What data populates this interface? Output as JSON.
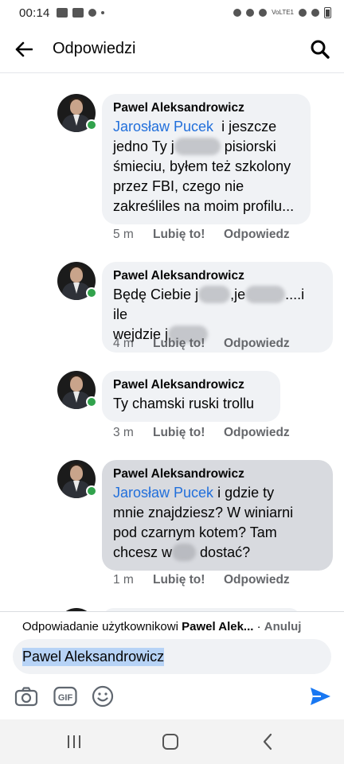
{
  "status_bar": {
    "time": "00:14",
    "volte_label": "VoLTE1",
    "icons": [
      "image-icon",
      "youtube-icon",
      "download-icon",
      "dot-icon",
      "alarm-icon",
      "mute-icon",
      "wifi-icon",
      "signal-icon",
      "signal-2-icon",
      "battery-icon"
    ]
  },
  "header": {
    "title": "Odpowiedzi",
    "back_icon": "arrow-left-icon",
    "search_icon": "search-icon"
  },
  "comments": [
    {
      "author": "Pawel Aleksandrowicz",
      "mention": "Jarosław Pucek",
      "parts": [
        "i jeszcze",
        "jedno Ty j",
        "pisiorski",
        "śmieciu,  byłem też szkolony",
        "przez FBI,  czego nie",
        "zakreśliles na moim profilu..."
      ],
      "time": "5 m",
      "like": "Lubię to!",
      "reply": "Odpowiedz"
    },
    {
      "author": "Pawel Aleksandrowicz",
      "parts": [
        "Będę Ciebie j",
        ",je",
        "....i ile",
        "wejdzie j"
      ],
      "time": "4 m",
      "like": "Lubię to!",
      "reply": "Odpowiedz"
    },
    {
      "author": "Pawel Aleksandrowicz",
      "text": "Ty chamski ruski trollu",
      "time": "3 m",
      "like": "Lubię to!",
      "reply": "Odpowiedz"
    },
    {
      "author": "Pawel Aleksandrowicz",
      "mention": "Jarosław Pucek",
      "parts": [
        "i gdzie ty",
        "mnie znajdziesz? W winiarni",
        "pod czarnym kotem? Tam",
        "chcesz w",
        "dostać?"
      ],
      "time": "1 m",
      "like": "Lubię to!",
      "reply": "Odpowiedz"
    }
  ],
  "composer": {
    "replying_prefix": "Odpowiadanie użytkownikowi",
    "replying_name": "Pawel Alek...",
    "separator": "·",
    "cancel": "Anuluj",
    "input_value": "Pawel Aleksandrowicz",
    "gif_label": "GIF"
  },
  "colors": {
    "mention": "#216fdb",
    "send": "#1877f2",
    "online": "#31a24c",
    "bubble": "#f0f2f5",
    "bubble_active": "#d8dadf"
  }
}
